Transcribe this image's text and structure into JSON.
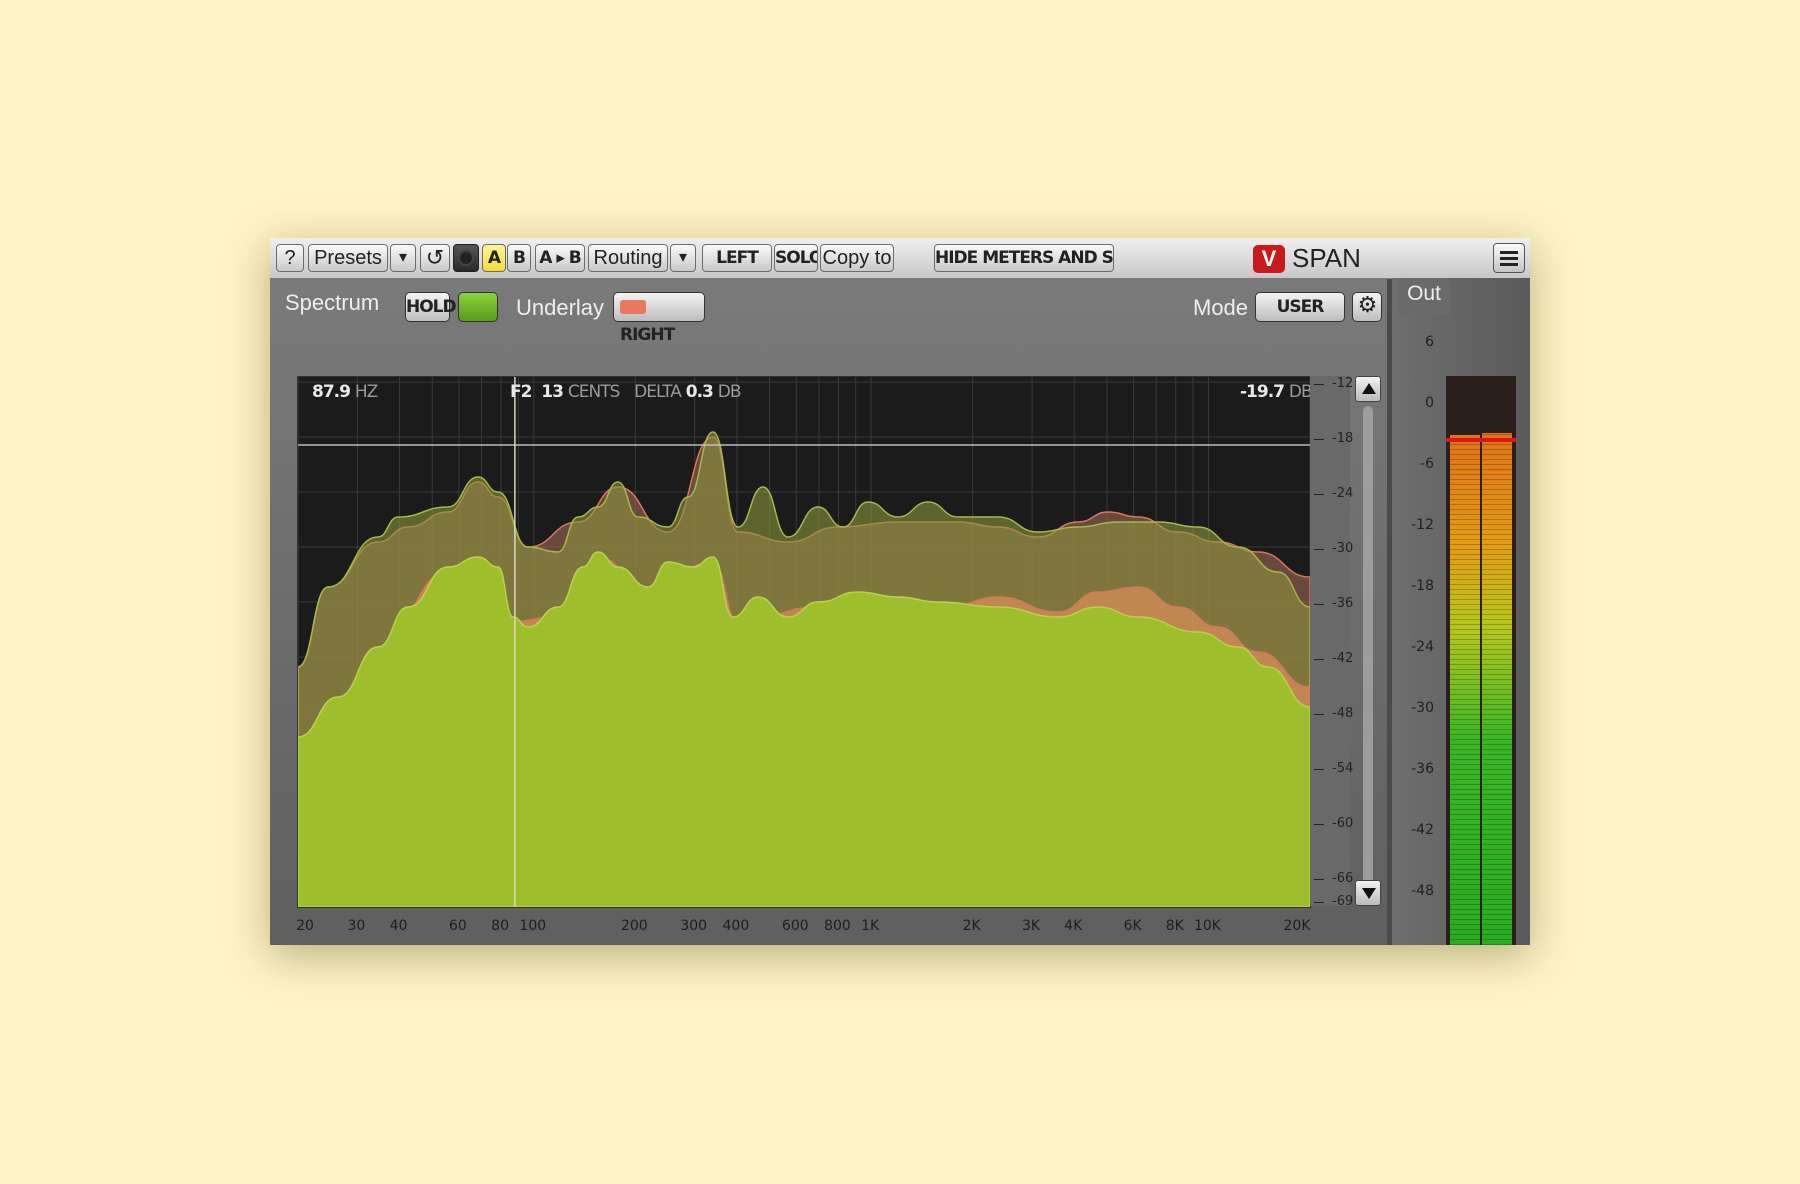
{
  "toolbar": {
    "help_label": "?",
    "presets_label": "Presets",
    "dropdown_label": "▾",
    "undo_label": "↺",
    "a_label": "A",
    "b_label": "B",
    "ab_label": "A ▸ B",
    "routing_label": "Routing",
    "left_label": "LEFT",
    "solo_label": "SOLO",
    "copy_to_label": "Copy to",
    "hide_meters_label": "HIDE METERS AND STATS",
    "logo_letter": "V",
    "app_name": "SPAN"
  },
  "spectrum": {
    "section_label": "Spectrum",
    "hold_label": "HOLD",
    "underlay_label": "Underlay",
    "right_label": "RIGHT",
    "mode_label": "Mode",
    "mode_value": "USER",
    "readout": {
      "freq_value": "87.9",
      "freq_unit": "HZ",
      "note": "F2",
      "cents_value": "13",
      "cents_unit": "CENTS",
      "delta_label": "DELTA",
      "delta_value": "0.3",
      "delta_unit": "DB",
      "level_value": "-19.7",
      "level_unit": "DB"
    },
    "colors": {
      "main": "#9fbe2c",
      "underlay": "#d8785a"
    },
    "db_ticks": [
      "-12",
      "-18",
      "-24",
      "-30",
      "-36",
      "-42",
      "-48",
      "-54",
      "-60",
      "-66",
      "-69"
    ],
    "freq_ticks": [
      "20",
      "30",
      "40",
      "60",
      "80",
      "100",
      "200",
      "300",
      "400",
      "600",
      "800",
      "1K",
      "2K",
      "3K",
      "4K",
      "6K",
      "8K",
      "10K",
      "20K"
    ]
  },
  "meter": {
    "tab_label": "Out",
    "scale": [
      "6",
      "0",
      "-6",
      "-12",
      "-18",
      "-24",
      "-30",
      "-36",
      "-42",
      "-48"
    ],
    "peak_color": "#e01616"
  }
}
